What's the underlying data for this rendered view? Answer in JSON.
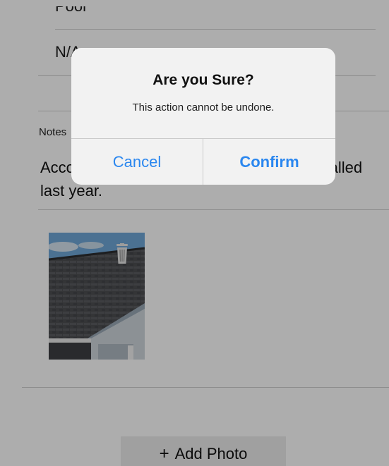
{
  "form": {
    "rows": [
      {
        "label": "Pool"
      },
      {
        "label": "N/A"
      }
    ],
    "notes": {
      "label": "Notes",
      "text": "According to homeowner the roof was installed last year."
    },
    "photo": {
      "alt": "roof photo",
      "delete_icon": "trash-icon"
    },
    "add_photo": {
      "icon": "plus-icon",
      "label": "Add Photo"
    }
  },
  "dialog": {
    "title": "Are you Sure?",
    "message": "This action cannot be undone.",
    "cancel_label": "Cancel",
    "confirm_label": "Confirm"
  },
  "colors": {
    "accent": "#2b87ef",
    "overlay": "rgba(0,0,0,0.32)",
    "dialog_bg": "#f2f2f2"
  }
}
